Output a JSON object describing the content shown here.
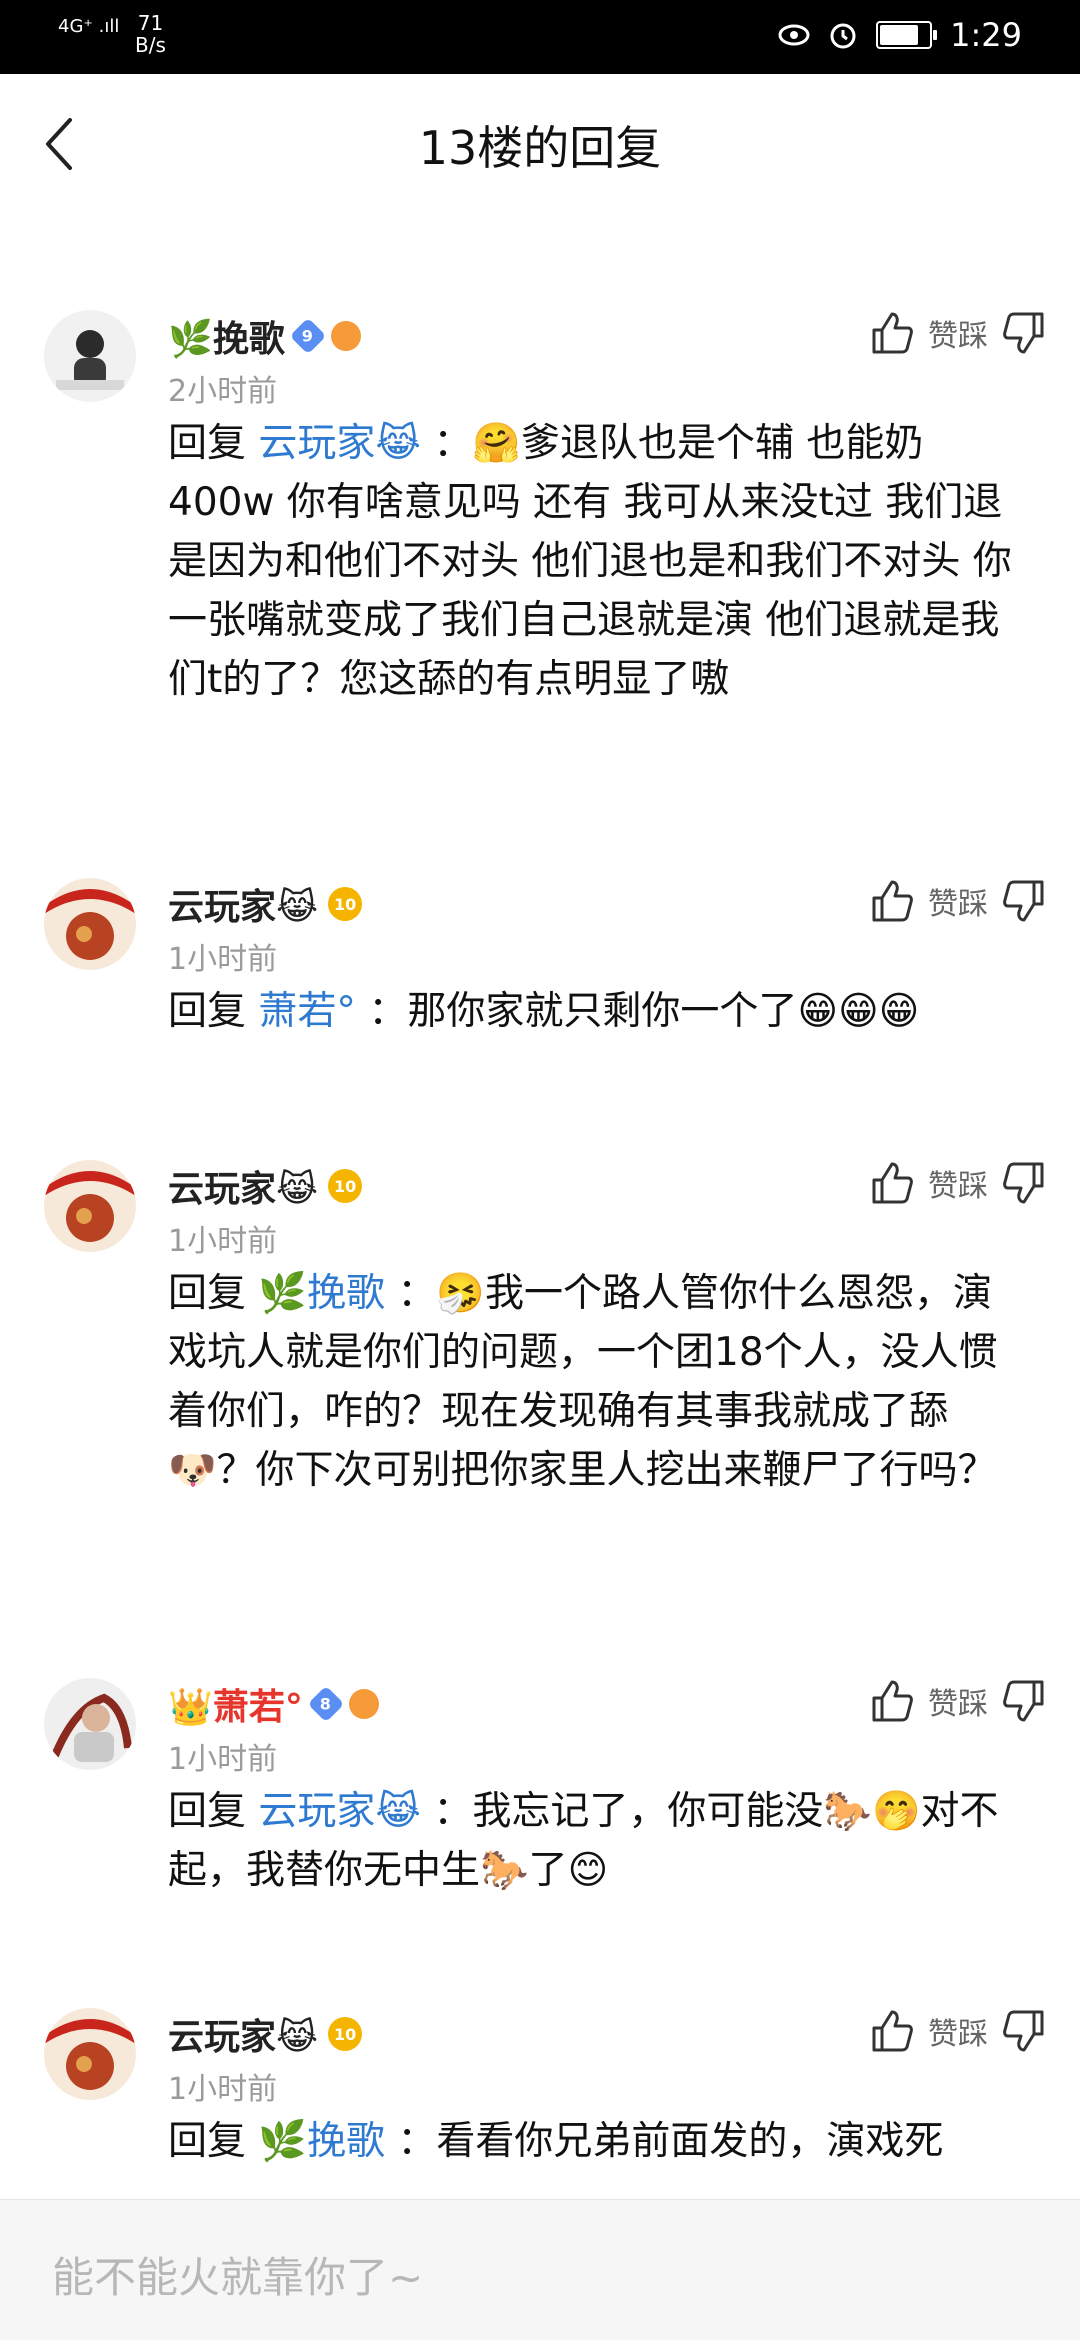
{
  "statusbar": {
    "signal": "4G⁺ .ıll",
    "speed_top": "71",
    "speed_bottom": "B/s",
    "time": "1:29",
    "battery_level": 0.72
  },
  "header": {
    "title": "13楼的回复"
  },
  "comments": [
    {
      "name": "🌿挽歌",
      "badge": "9",
      "time": "2小时前",
      "actions": "赞踩",
      "reply_prefix": "回复",
      "reply_to": "云玩家😹",
      "content": "：🤗爹退队也是个辅 也能奶400w 你有啥意见吗 还有 我可从来没t过 我们退是因为和他们不对头 他们退也是和我们不对头 你一张嘴就变成了我们自己退就是演 他们退就是我们t的了？您这舔的有点明显了嗷"
    },
    {
      "name": "云玩家😹",
      "badge": "10",
      "time": "1小时前",
      "actions": "赞踩",
      "reply_prefix": "回复",
      "reply_to": "萧若°",
      "content": "：那你家就只剩你一个了😁😁😁"
    },
    {
      "name": "云玩家😹",
      "badge": "10",
      "time": "1小时前",
      "actions": "赞踩",
      "reply_prefix": "回复",
      "reply_to": "🌿挽歌",
      "content": "：🤧我一个路人管你什么恩怨，演戏坑人就是你们的问题，一个团18个人，没人惯着你们，咋的？现在发现确有其事我就成了舔🐶？你下次可别把你家里人挖出来鞭尸了行吗？"
    },
    {
      "name": "👑萧若°",
      "badge": "8",
      "time": "1小时前",
      "actions": "赞踩",
      "reply_prefix": "回复",
      "reply_to": "云玩家😹",
      "content": "：我忘记了，你可能没🐎🤭对不起，我替你无中生🐎了😊"
    },
    {
      "name": "云玩家😹",
      "badge": "10",
      "time": "1小时前",
      "actions": "赞踩",
      "reply_prefix": "回复",
      "reply_to": "🌿挽歌",
      "content": "：看看你兄弟前面发的，演戏死"
    }
  ],
  "input": {
    "placeholder": "能不能火就靠你了~"
  }
}
